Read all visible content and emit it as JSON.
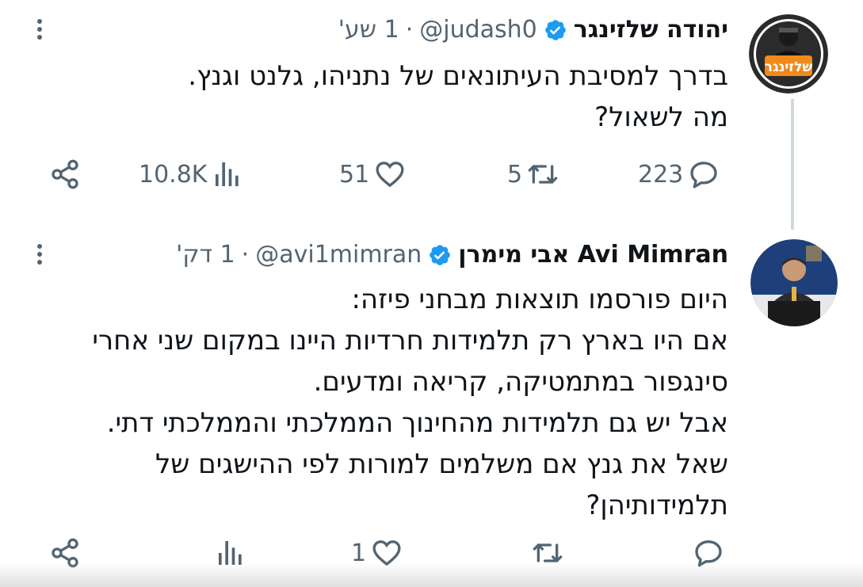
{
  "tweets": [
    {
      "display_name": "יהודה שלזינגר",
      "handle": "@judash0",
      "separator": "·",
      "time": "1 שע'",
      "body_lines": [
        "בדרך למסיבת העיתונאים של נתניהו, גלנט וגנץ.",
        "מה לשאול?"
      ],
      "stats": {
        "replies": "223",
        "reposts": "5",
        "likes": "51",
        "views": "10.8K"
      },
      "avatar_text": "שלזינגר",
      "avatar_colors": {
        "bg": "#2b2b2b",
        "accent": "#f08a1c"
      }
    },
    {
      "display_name": "Avi Mimran אבי מימרן",
      "handle": "@avi1mimran",
      "separator": "·",
      "time": "1 דק'",
      "body_lines": [
        "היום פורסמו תוצאות מבחני פיזה:",
        "אם היו בארץ רק תלמידות חרדיות היינו במקום שני אחרי",
        "סינגפור במתמטיקה, קריאה ומדעים.",
        "אבל יש גם תלמידות מהחינוך הממלכתי והממלכתי דתי.",
        "שאל את גנץ אם משלמים למורות לפי ההישגים של",
        "תלמידותיהן?"
      ],
      "stats": {
        "replies": "",
        "reposts": "",
        "likes": "1",
        "views": ""
      },
      "avatar_colors": {
        "bg": "#1e3f7a",
        "accent": "#e0b24a"
      }
    }
  ],
  "icons": [
    "verified-badge-icon",
    "more-icon",
    "reply-icon",
    "repost-icon",
    "like-icon",
    "views-icon",
    "share-icon"
  ],
  "colors": {
    "text": "#0f1419",
    "secondary": "#536471",
    "verified": "#1d9bf0",
    "thread_line": "#cfd9de"
  }
}
